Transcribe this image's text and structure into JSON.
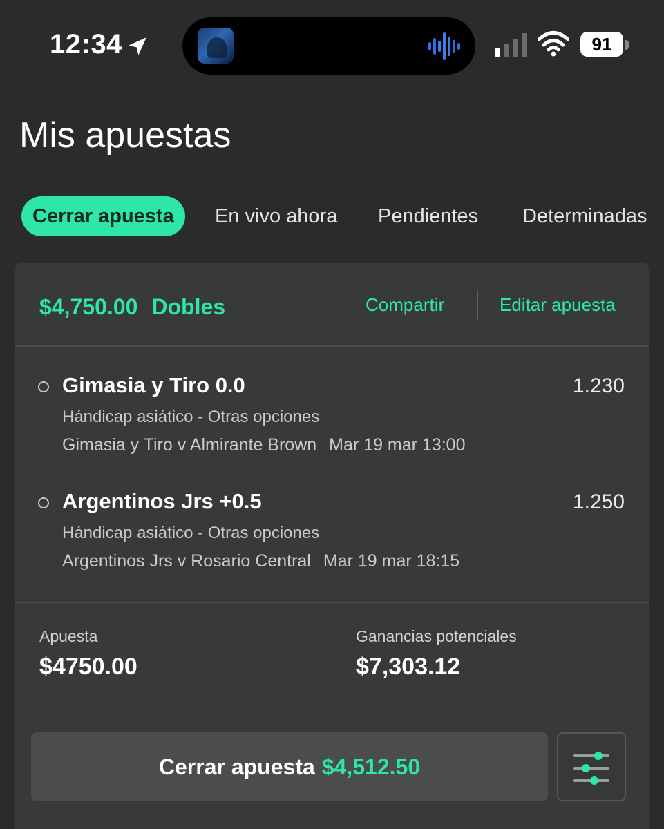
{
  "status_bar": {
    "time": "12:34",
    "battery": "91",
    "icons": [
      "location-arrow-icon",
      "album-art-icon",
      "waveform-icon",
      "cellular-signal-icon",
      "wifi-icon",
      "battery-icon"
    ]
  },
  "page": {
    "title": "Mis apuestas"
  },
  "tabs": [
    {
      "label": "Cerrar apuesta",
      "active": true
    },
    {
      "label": "En vivo ahora",
      "active": false
    },
    {
      "label": "Pendientes",
      "active": false
    },
    {
      "label": "Determinadas",
      "active": false
    }
  ],
  "bet": {
    "amount": "$4,750.00",
    "type": "Dobles",
    "share_label": "Compartir",
    "edit_label": "Editar apuesta",
    "selections": [
      {
        "name": "Gimasia y Tiro 0.0",
        "odds": "1.230",
        "market": "Hándicap asiático - Otras opciones",
        "event": "Gimasia y Tiro v Almirante Brown",
        "date": "Mar 19 mar 13:00"
      },
      {
        "name": "Argentinos Jrs +0.5",
        "odds": "1.250",
        "market": "Hándicap asiático - Otras opciones",
        "event": "Argentinos Jrs v Rosario Central",
        "date": "Mar 19 mar 18:15"
      }
    ],
    "stake_label": "Apuesta",
    "stake_value": "$4750.00",
    "returns_label": "Ganancias potenciales",
    "returns_value": "$7,303.12",
    "cashout_label": "Cerrar apuesta",
    "cashout_amount": "$4,512.50"
  },
  "colors": {
    "accent": "#2ee6a6",
    "background": "#2a2b2b",
    "card": "#373a39"
  }
}
